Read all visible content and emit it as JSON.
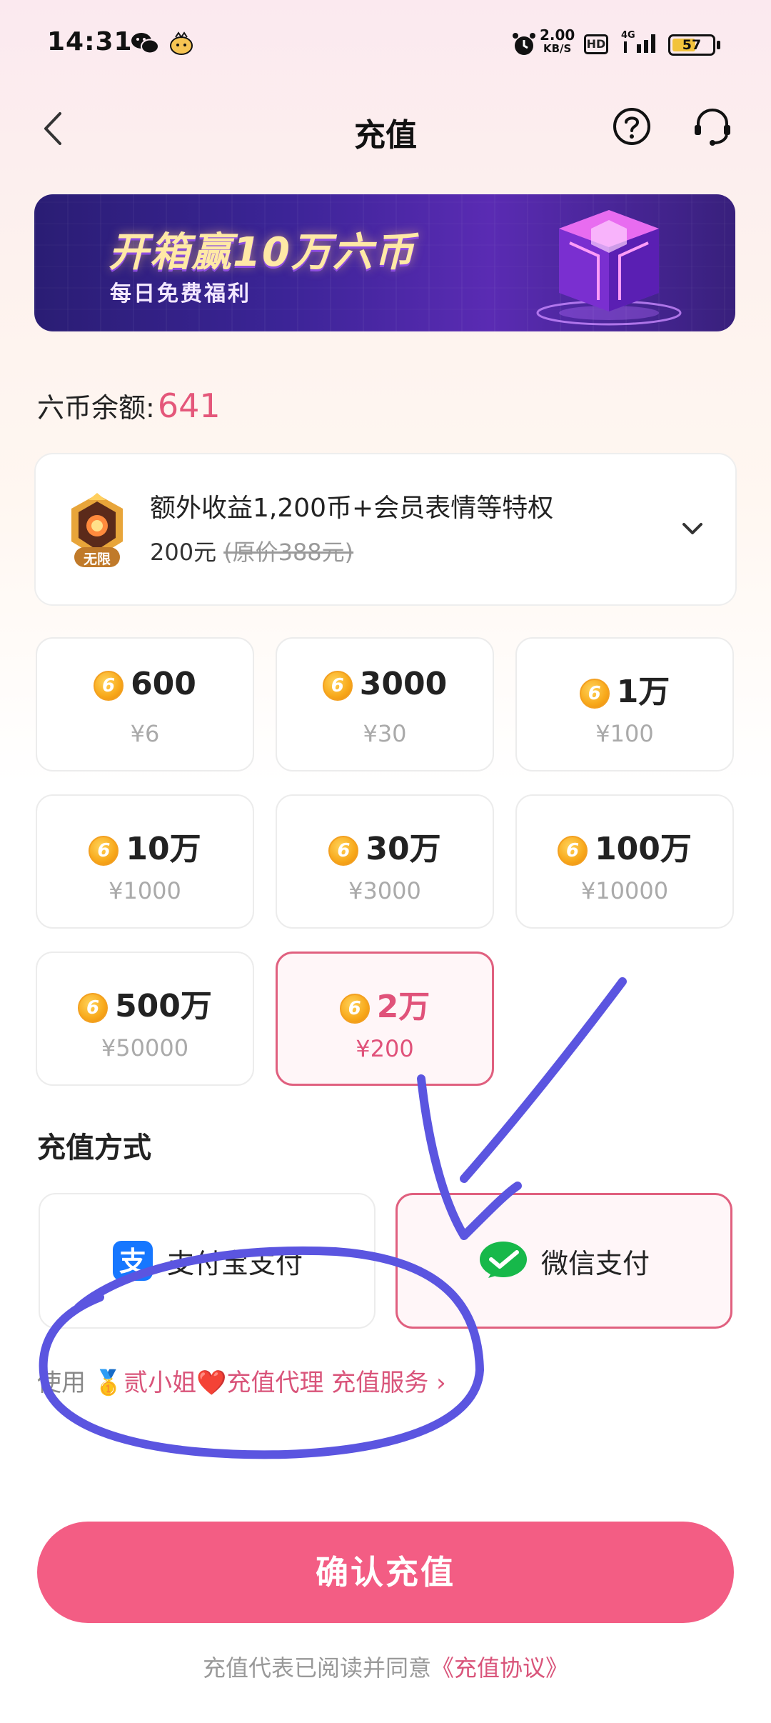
{
  "status_bar": {
    "time": "14:31",
    "speed_value": "2.00",
    "speed_unit": "KB/S",
    "hd": "HD",
    "network": "4G",
    "battery": "57"
  },
  "header": {
    "title": "充值"
  },
  "banner": {
    "title": "开箱赢10万六币",
    "subtitle": "每日免费福利"
  },
  "balance": {
    "label": "六币余额:",
    "value": "641"
  },
  "vip": {
    "badge_text": "无限",
    "title": "额外收益1,200币+会员表情等特权",
    "price": "200元",
    "original_price": "(原价388元)"
  },
  "coin_glyph": "6",
  "packages": [
    {
      "amount": "600",
      "price": "¥6"
    },
    {
      "amount": "3000",
      "price": "¥30"
    },
    {
      "amount": "1万",
      "price": "¥100"
    },
    {
      "amount": "10万",
      "price": "¥1000"
    },
    {
      "amount": "30万",
      "price": "¥3000"
    },
    {
      "amount": "100万",
      "price": "¥10000"
    },
    {
      "amount": "500万",
      "price": "¥50000"
    },
    {
      "amount": "2万",
      "price": "¥200",
      "selected": true
    }
  ],
  "payment": {
    "section_title": "充值方式",
    "alipay_label": "支付宝支付",
    "wechat_label": "微信支付",
    "selected": "wechat"
  },
  "agent": {
    "prefix": "使用",
    "link": "贰小姐❤️充值代理 充值服务 ›"
  },
  "confirm": {
    "label": "确认充值"
  },
  "agreement": {
    "text": "充值代表已阅读并同意",
    "link": "《充值协议》"
  },
  "colors": {
    "accent": "#f35d84",
    "selected_border": "#e0607f",
    "balance": "#e4577a",
    "annotation": "#5b55e0"
  }
}
